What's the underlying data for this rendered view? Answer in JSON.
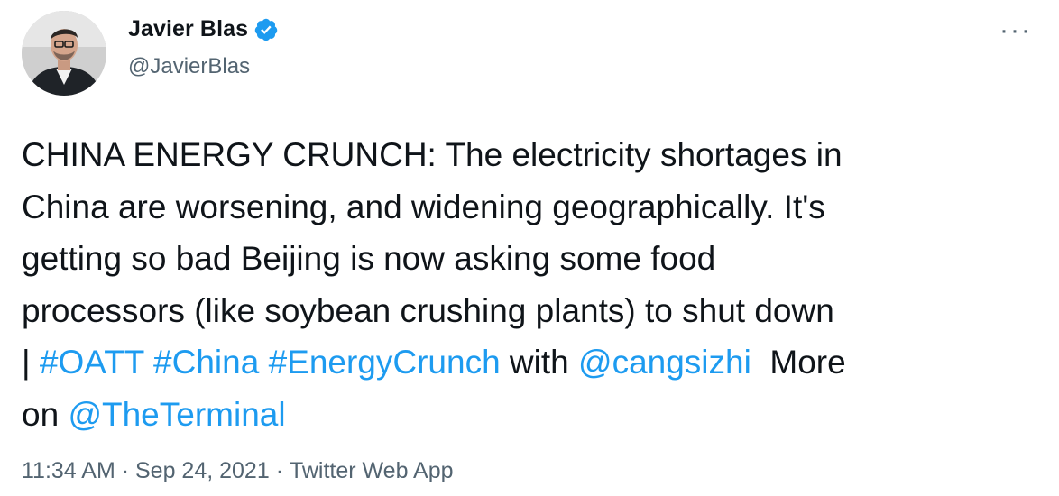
{
  "author": {
    "name": "Javier Blas",
    "handle": "@JavierBlas",
    "verified_icon": "verified-badge-icon"
  },
  "more_label": "···",
  "tweet": {
    "line1": "CHINA ENERGY CRUNCH: The electricity shortages in",
    "line2": "China are worsening, and widening geographically. It's",
    "line3": "getting so bad Beijing is now asking some food",
    "line4": "processors (like soybean crushing plants) to shut down",
    "line5_prefix": "| ",
    "hashtag1": "#OATT",
    "hashtag2": "#China",
    "hashtag3": "#EnergyCrunch",
    "with_text": " with ",
    "mention1": "@cangsizhi",
    "more_text": "  More",
    "on_text": "on ",
    "mention2": "@TheTerminal"
  },
  "meta": {
    "time": "11:34 AM",
    "separator": " · ",
    "date": "Sep 24, 2021",
    "source": "Twitter Web App"
  },
  "colors": {
    "link": "#1d9bf0",
    "secondary": "#536471",
    "text": "#0f1419"
  }
}
